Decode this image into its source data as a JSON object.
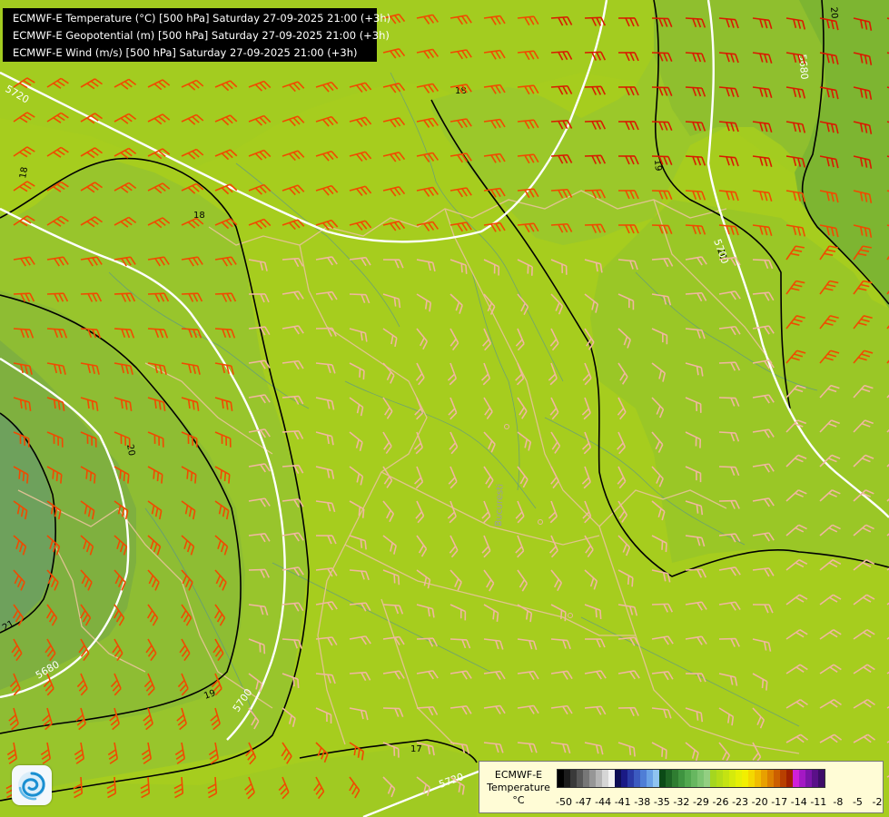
{
  "title_lines": [
    "ECMWF-E Temperature (°C) [500 hPa] Saturday 27-09-2025 21:00 (+3h)",
    "ECMWF-E Geopotential (m) [500 hPa] Saturday 27-09-2025 21:00 (+3h)",
    "ECMWF-E Wind (m/s) [500 hPa] Saturday 27-09-2025 21:00 (+3h)"
  ],
  "legend": {
    "line1": "ECMWF-E",
    "line2": "Temperature",
    "unit": "°C",
    "ticks": [
      "-50",
      "-47",
      "-44",
      "-41",
      "-38",
      "-35",
      "-32",
      "-29",
      "-26",
      "-23",
      "-20",
      "-17",
      "-14",
      "-11",
      "-8",
      "-5",
      "-2"
    ],
    "colors": [
      "#000000",
      "#1c1c1c",
      "#3a3a3a",
      "#585858",
      "#777777",
      "#969696",
      "#b5b5b5",
      "#d6d6d6",
      "#f2f2f2",
      "#0d0d55",
      "#1a1a85",
      "#2a3aa5",
      "#3c5bc0",
      "#4f7ed6",
      "#6aa2e6",
      "#8fc4f0",
      "#0b4a16",
      "#1d6424",
      "#2f7d31",
      "#3f9440",
      "#52a84f",
      "#67b760",
      "#7dc471",
      "#93cf82",
      "#a5d61f",
      "#b4dc18",
      "#c4e312",
      "#d5ea0c",
      "#e5f006",
      "#f2ef00",
      "#f4d800",
      "#f0bd00",
      "#e8a000",
      "#dc8000",
      "#cc5f00",
      "#b83f00",
      "#a02000",
      "#d020d8",
      "#a418c4",
      "#7c14a8",
      "#5a1088",
      "#3d0c68"
    ]
  },
  "contour_labels": {
    "temp": [
      "18",
      "18",
      "18",
      "19",
      "20",
      "20",
      "21",
      "17",
      "19",
      "20"
    ],
    "geo": [
      "5720",
      "5680",
      "5700",
      "5720",
      "5700",
      "5680"
    ]
  },
  "city_label": "Bucuresti"
}
